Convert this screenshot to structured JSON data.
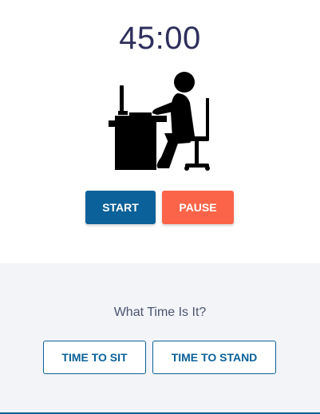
{
  "timer": {
    "display": "45:00"
  },
  "illustration": {
    "icon": "person-sitting-at-desk-icon"
  },
  "controls": {
    "start_label": "START",
    "pause_label": "PAUSE"
  },
  "mode": {
    "question": "What Time Is It?",
    "sit_label": "TIME TO SIT",
    "stand_label": "TIME TO STAND"
  },
  "colors": {
    "primary": "#0b6199",
    "pause": "#fb6448",
    "timer_text": "#2e2f5c",
    "section_bg": "#f2f4f7"
  }
}
